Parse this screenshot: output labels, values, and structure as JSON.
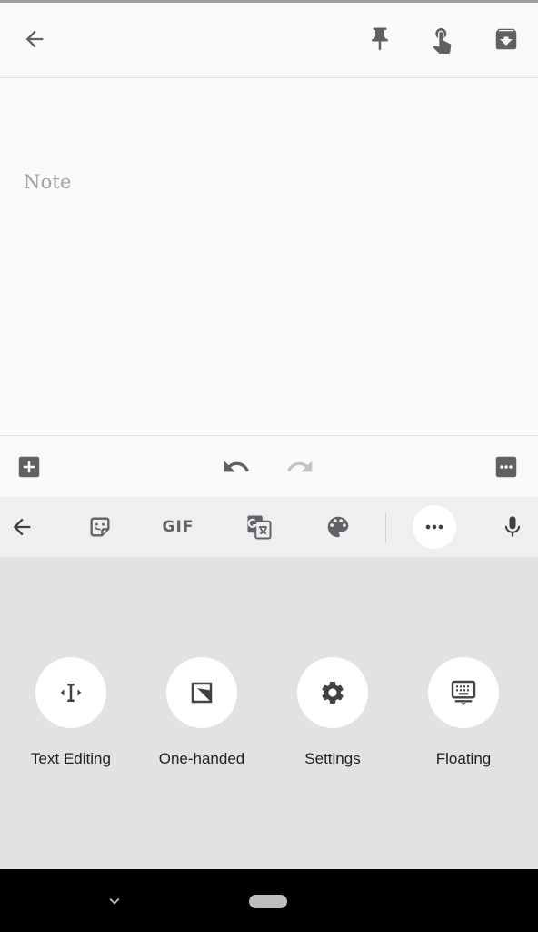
{
  "appbar": {
    "back_icon": "arrow-back-icon",
    "pin_icon": "pin-icon",
    "reminder_icon": "reminder-hand-icon",
    "archive_icon": "archive-icon"
  },
  "note": {
    "placeholder": "Note"
  },
  "note_toolbar": {
    "add_icon": "add-box-icon",
    "undo_icon": "undo-icon",
    "redo_icon": "redo-icon",
    "more_icon": "more-box-icon"
  },
  "keyboard_toolbar": {
    "back_icon": "arrow-back-icon",
    "sticker_icon": "sticker-icon",
    "gif_label": "GIF",
    "translate_icon": "translate-icon",
    "theme_icon": "palette-icon",
    "more_icon": "more-horiz-icon",
    "mic_icon": "mic-icon"
  },
  "keyboard_panel": {
    "tools": [
      {
        "label": "Text Editing",
        "icon": "text-cursor-icon"
      },
      {
        "label": "One-handed",
        "icon": "one-handed-icon"
      },
      {
        "label": "Settings",
        "icon": "gear-icon"
      },
      {
        "label": "Floating",
        "icon": "floating-keyboard-icon"
      }
    ]
  },
  "navbar": {
    "hide_keyboard_icon": "chevron-down-icon",
    "home_icon": "home-pill-icon"
  },
  "colors": {
    "icon": "#616161",
    "panel": "#e2e2e2",
    "toolbar": "#efefef",
    "navbar": "#000000"
  }
}
